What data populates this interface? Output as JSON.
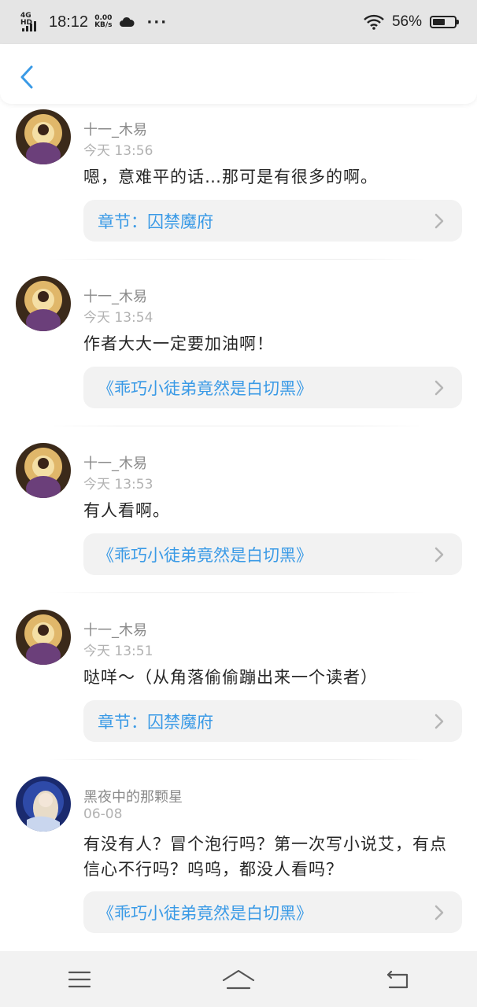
{
  "status_bar": {
    "network": "4G HD",
    "time": "18:12",
    "speed_value": "0.00",
    "speed_unit": "KB/s",
    "overflow": "···",
    "battery_percent": "56%",
    "battery_level": 0.56
  },
  "header": {
    "back_icon": "chevron-left-icon",
    "accent_color": "#3a9ae6"
  },
  "comments": [
    {
      "user": "十一_木易",
      "date": "今天 13:56",
      "text": "嗯，意难平的话…那可是有很多的啊。",
      "card": "章节：囚禁魔府",
      "avatar": "avatar-warrior"
    },
    {
      "user": "十一_木易",
      "date": "今天 13:54",
      "text": "作者大大一定要加油啊！",
      "card": "《乖巧小徒弟竟然是白切黑》",
      "avatar": "avatar-warrior"
    },
    {
      "user": "十一_木易",
      "date": "今天 13:53",
      "text": "有人看啊。",
      "card": "《乖巧小徒弟竟然是白切黑》",
      "avatar": "avatar-warrior"
    },
    {
      "user": "十一_木易",
      "date": "今天 13:51",
      "text": "哒咩～（从角落偷偷蹦出来一个读者）",
      "card": "章节：囚禁魔府",
      "avatar": "avatar-warrior"
    },
    {
      "user": "黑夜中的那颗星",
      "date": "06-08",
      "text": "有没有人？冒个泡行吗？第一次写小说艾，有点信心不行吗？呜呜，都没人看吗？",
      "card": "《乖巧小徒弟竟然是白切黑》",
      "avatar": "avatar-anime-girl"
    }
  ],
  "system_nav": {
    "menu_icon": "menu-icon",
    "home_icon": "home-icon",
    "back_icon": "back-arrow-icon"
  }
}
